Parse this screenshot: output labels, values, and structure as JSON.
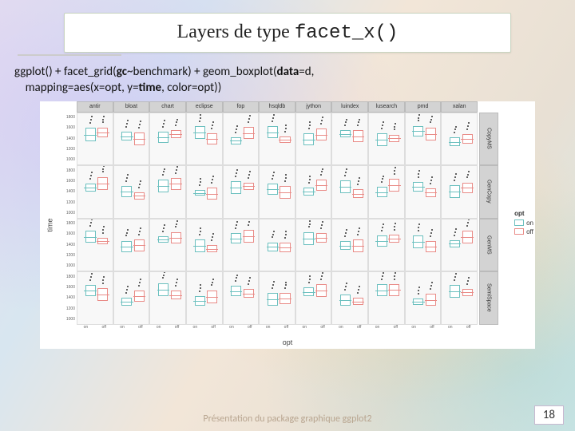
{
  "title_prefix": "Layers de type ",
  "title_mono": "facet_x()",
  "code_line1a": "ggplot() + facet_grid(",
  "code_line1b": "gc",
  "code_line1c": "~benchmark) + geom_boxplot(",
  "code_line1d": "data",
  "code_line1e": "=d,",
  "code_line2a": "mapping=aes(x=opt, y=",
  "code_line2b": "time",
  "code_line2c": ", color=opt))",
  "footer_text": "Présentation du package graphique ggplot2",
  "page_number": "18",
  "chart_data": {
    "type": "boxplot",
    "facet_cols_label": "benchmark",
    "facet_rows_label": "gc",
    "xlabel": "opt",
    "ylabel": "time",
    "legend": {
      "title": "opt",
      "items": [
        "on",
        "off"
      ],
      "colors": [
        "#6cc0bf",
        "#e98b87"
      ]
    },
    "facet_cols": [
      "antir",
      "bloat",
      "chart",
      "eclipse",
      "fop",
      "hsqldb",
      "jython",
      "luindex",
      "lusearch",
      "pmd",
      "xalan"
    ],
    "facet_rows": [
      "CopyMS",
      "GenCopy",
      "GenMS",
      "SemiSpace"
    ],
    "x_categories": [
      "on",
      "off"
    ],
    "yticks": [
      1000,
      1200,
      1400,
      1600,
      1800
    ],
    "ylim": [
      900,
      1900
    ],
    "note": "Each facet cell shows two boxplots (on=teal, off=salmon) with outlier points; medians roughly 1100–1400 across cells with spread ~1000–1800."
  }
}
